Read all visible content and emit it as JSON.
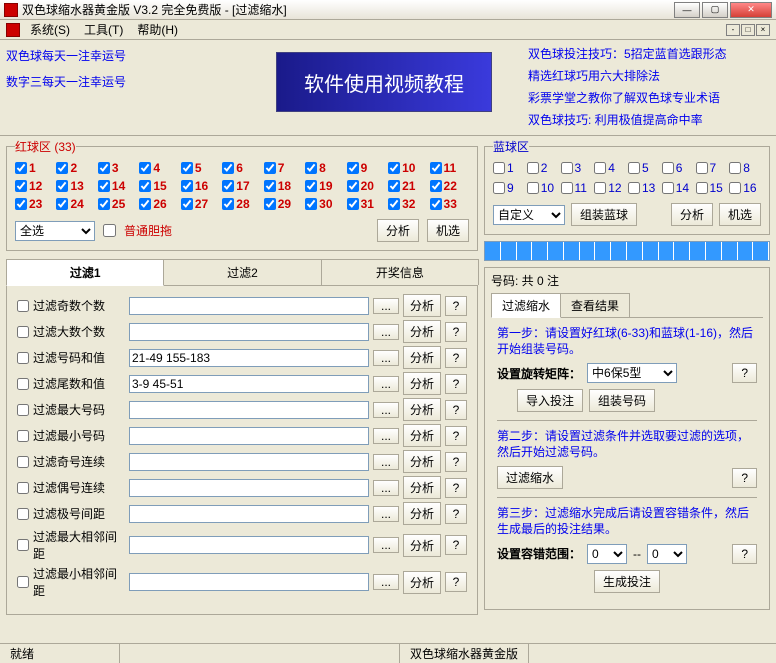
{
  "title": "双色球缩水器黄金版 V3.2   完全免费版 - [过滤缩水]",
  "menu": {
    "system": "系统(S)",
    "tool": "工具(T)",
    "help": "帮助(H)"
  },
  "leftLinks": [
    "双色球每天一注幸运号",
    "数字三每天一注幸运号"
  ],
  "banner": "软件使用视频教程",
  "rightLinks": [
    "双色球投注技巧：5招定蓝首选跟形态",
    "精选红球巧用六大排除法",
    "彩票学堂之教你了解双色球专业术语",
    "双色球技巧: 利用极值提高命中率"
  ],
  "redZone": {
    "legend": "红球区 (33)",
    "count": 33
  },
  "blueZone": {
    "legend": "蓝球区",
    "count": 16
  },
  "selAll": "全选",
  "danTuo": "普通胆拖",
  "analyze": "分析",
  "random": "机选",
  "customSel": "自定义",
  "assembleBlue": "组装蓝球",
  "tabs": [
    "过滤1",
    "过滤2",
    "开奖信息"
  ],
  "filters": [
    {
      "label": "过滤奇数个数",
      "val": ""
    },
    {
      "label": "过滤大数个数",
      "val": ""
    },
    {
      "label": "过滤号码和值",
      "val": "21-49 155-183"
    },
    {
      "label": "过滤尾数和值",
      "val": "3-9 45-51"
    },
    {
      "label": "过滤最大号码",
      "val": ""
    },
    {
      "label": "过滤最小号码",
      "val": ""
    },
    {
      "label": "过滤奇号连续",
      "val": ""
    },
    {
      "label": "过滤偶号连续",
      "val": ""
    },
    {
      "label": "过滤极号间距",
      "val": ""
    },
    {
      "label": "过滤最大相邻间距",
      "val": ""
    },
    {
      "label": "过滤最小相邻间距",
      "val": ""
    }
  ],
  "btnDots": "...",
  "btnHelp": "?",
  "rightHeader": "号码: 共 0 注",
  "rtabs": [
    "过滤缩水",
    "查看结果"
  ],
  "step1": "第一步：请设置好红球(6-33)和蓝球(1-16)，然后开始组装号码。",
  "rotLabel": "设置旋转矩阵：",
  "rotSel": "中6保5型",
  "importBet": "导入投注",
  "assembleNum": "组装号码",
  "step2": "第二步：请设置过滤条件并选取要过滤的选项，然后开始过滤号码。",
  "filterShrink": "过滤缩水",
  "step3": "第三步：过滤缩水完成后请设置容错条件，然后生成最后的投注结果。",
  "tolLabel": "设置容错范围：",
  "tol1": "0",
  "tolDash": "--",
  "tol2": "0",
  "genBet": "生成投注",
  "status1": "就绪",
  "status2": "双色球缩水器黄金版"
}
